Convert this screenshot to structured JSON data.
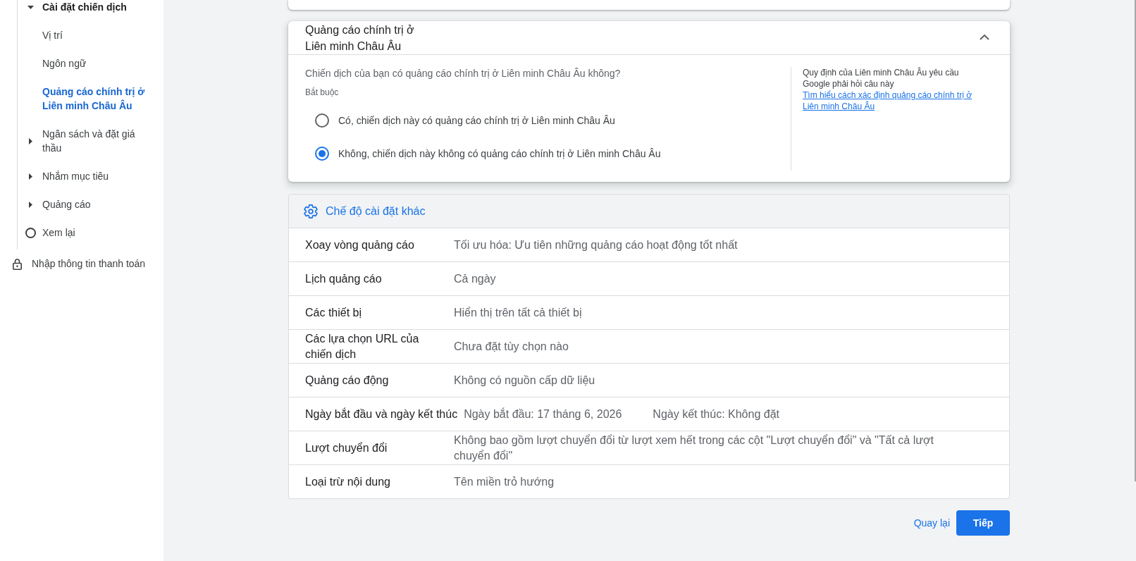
{
  "sidebar": {
    "sections": [
      {
        "label": "Cài đặt chiến dịch",
        "expanded": true,
        "selected": false,
        "children": [
          {
            "label": "Vị trí",
            "selected": false
          },
          {
            "label": "Ngôn ngữ",
            "selected": false
          },
          {
            "label": "Quảng cáo chính trị ở Liên minh Châu Âu",
            "selected": true
          }
        ]
      },
      {
        "label": "Ngân sách và đặt giá thầu",
        "expanded": false,
        "selected": false
      },
      {
        "label": "Nhắm mục tiêu",
        "expanded": false,
        "selected": false
      },
      {
        "label": "Quảng cáo",
        "expanded": false,
        "selected": false
      }
    ],
    "steps": [
      {
        "label": "Xem lại",
        "kind": "pending"
      },
      {
        "label": "Nhập thông tin thanh toán",
        "kind": "locked"
      }
    ]
  },
  "eu_political_ads": {
    "title": "Quảng cáo chính trị ở Liên minh Châu Âu",
    "expanded": true,
    "question": "Chiến dịch của bạn có quảng cáo chính trị ở Liên minh Châu Âu không?",
    "required_note": "Bắt buộc",
    "options": [
      {
        "label": "Có, chiến dịch này có quảng cáo chính trị ở Liên minh Châu Âu",
        "selected": false
      },
      {
        "label": "Không, chiến dịch này không có quảng cáo chính trị ở Liên minh Châu Âu",
        "selected": true
      }
    ],
    "help_text": "Quy định của Liên minh Châu Âu yêu cầu Google phải hỏi câu này",
    "help_link": "Tìm hiểu cách xác định quảng cáo chính trị ở Liên minh Châu Âu"
  },
  "other_settings": {
    "title": "Chế độ cài đặt khác",
    "rows": [
      {
        "kind": "setting",
        "label": "Xoay vòng quảng cáo",
        "value": "Tối ưu hóa: Ưu tiên những quảng cáo hoạt động tốt nhất"
      },
      {
        "kind": "setting",
        "label": "Lịch quảng cáo",
        "value": "Cả ngày"
      },
      {
        "kind": "setting",
        "label": "Các thiết bị",
        "value": "Hiển thị trên tất cả thiết bị"
      },
      {
        "kind": "setting",
        "label": "Các lựa chọn URL của chiến dịch",
        "value": "Chưa đặt tùy chọn nào"
      },
      {
        "kind": "setting",
        "label": "Quảng cáo động",
        "value": "Không có nguồn cấp dữ liệu"
      },
      {
        "kind": "date_range",
        "label": "Ngày bắt đầu và ngày kết thúc",
        "start": "Ngày bắt đầu: 17 tháng 6, 2026",
        "end": "Ngày kết thúc: Không đặt"
      },
      {
        "kind": "setting",
        "label": "Lượt chuyển đổi",
        "value": "Không bao gồm lượt chuyển đổi từ lượt xem hết trong các cột \"Lượt chuyển đổi\" và \"Tất cả lượt chuyển đổi\""
      },
      {
        "kind": "setting",
        "label": "Loại trừ nội dung",
        "value": "Tên miền trỏ hướng"
      }
    ]
  },
  "actions": [
    {
      "label": "Quay lại",
      "kind": "text"
    },
    {
      "label": "Tiếp",
      "kind": "filled"
    }
  ]
}
